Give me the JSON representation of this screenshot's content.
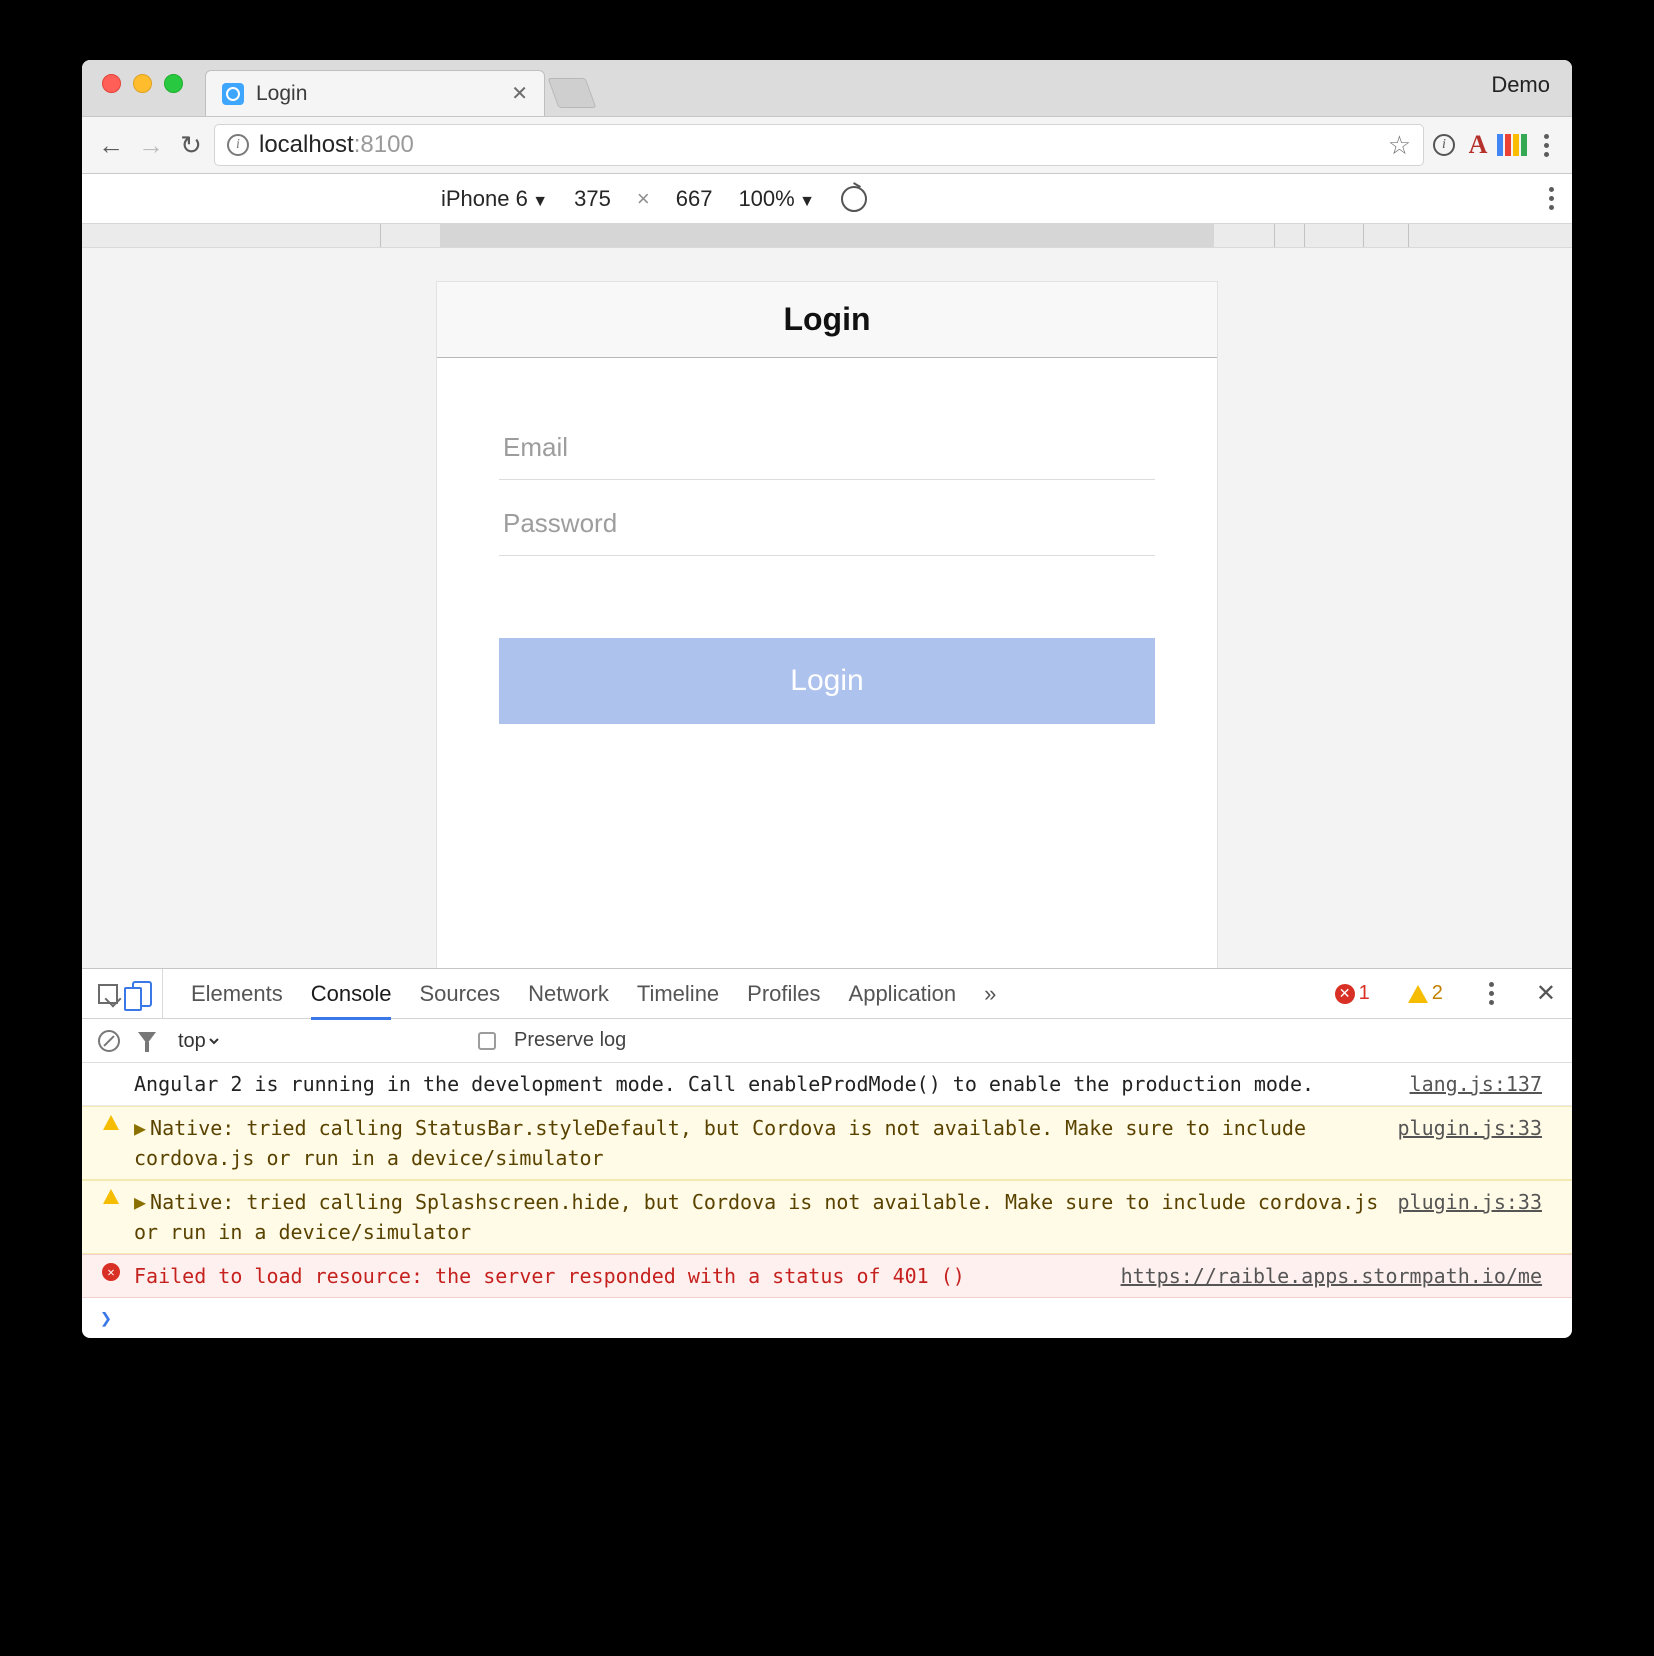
{
  "browser": {
    "tab_title": "Login",
    "demo_label": "Demo",
    "url_host": "localhost",
    "url_port": ":8100"
  },
  "device_toolbar": {
    "device": "iPhone 6",
    "width": "375",
    "height": "667",
    "zoom": "100%"
  },
  "app": {
    "header_title": "Login",
    "email_placeholder": "Email",
    "password_placeholder": "Password",
    "login_button": "Login"
  },
  "devtools": {
    "tabs": {
      "elements": "Elements",
      "console": "Console",
      "sources": "Sources",
      "network": "Network",
      "timeline": "Timeline",
      "profiles": "Profiles",
      "application": "Application",
      "more": "»"
    },
    "error_count": "1",
    "warn_count": "2",
    "filter_context": "top",
    "preserve_log_label": "Preserve log",
    "messages": [
      {
        "level": "log",
        "text": "Angular 2 is running in the development mode. Call enableProdMode() to enable the production mode.",
        "source": "lang.js:137"
      },
      {
        "level": "warn",
        "text": "Native: tried calling StatusBar.styleDefault, but Cordova is not available. Make sure to include cordova.js or run in a device/simulator",
        "source": "plugin.js:33"
      },
      {
        "level": "warn",
        "text": "Native: tried calling Splashscreen.hide, but Cordova is not available. Make sure to include cordova.js or run in a device/simulator",
        "source": "plugin.js:33"
      },
      {
        "level": "err",
        "text": "Failed to load resource: the server responded with a status of 401 ()",
        "source": "https://raible.apps.stormpath.io/me"
      }
    ]
  }
}
